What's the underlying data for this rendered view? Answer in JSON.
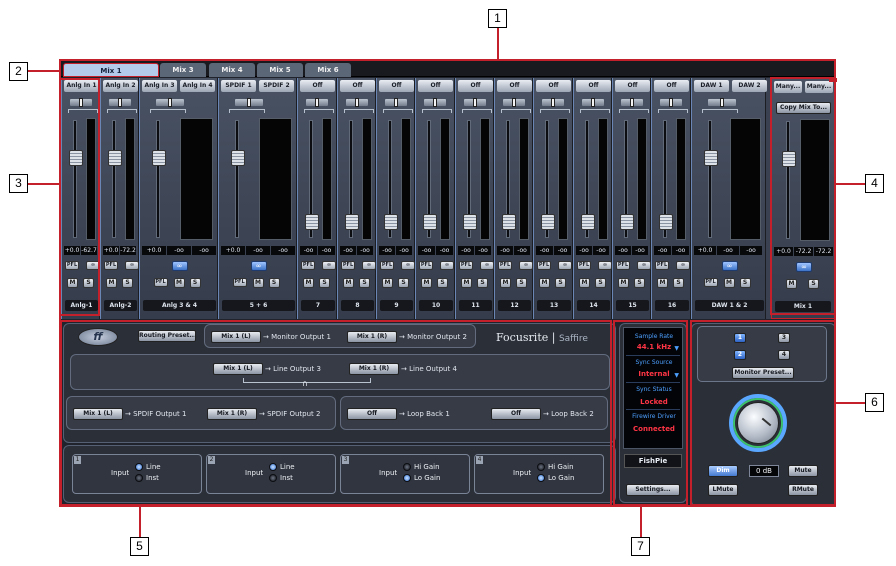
{
  "colors": {
    "accent_red": "#c4202c",
    "panel": "#20232b",
    "link_blue": "#3c72c7",
    "sync_red": "#ff3545",
    "sync_blue": "#4da0ff"
  },
  "tabs": [
    {
      "label": "Mix 1",
      "active": true
    },
    {
      "label": "Mix 3"
    },
    {
      "label": "Mix 4"
    },
    {
      "label": "Mix 5"
    },
    {
      "label": "Mix 6"
    }
  ],
  "groups": [
    {
      "label": "Anlg-1",
      "subs": [
        "Anlg In 1"
      ],
      "readouts": [
        "+0.0",
        "-62.7"
      ],
      "linked": false,
      "buttons": [
        "PFL",
        "M",
        "S"
      ]
    },
    {
      "label": "Anlg-2",
      "subs": [
        "Anlg In 2"
      ],
      "readouts": [
        "+0.0",
        "-72.2"
      ],
      "linked": false,
      "buttons": [
        "PFL",
        "M",
        "S"
      ]
    },
    {
      "label": "Anlg 3 & 4",
      "subs": [
        "Anlg In 3",
        "Anlg In 4"
      ],
      "readouts": [
        "+0.0",
        "-oo",
        "-oo"
      ],
      "linked": true,
      "buttons": [
        "PFL",
        "M",
        "S"
      ]
    },
    {
      "label": "5 + 6",
      "subs": [
        "SPDIF 1",
        "SPDIF 2"
      ],
      "readouts": [
        "+0.0",
        "-oo",
        "-oo"
      ],
      "linked": true,
      "buttons": [
        "PFL",
        "M",
        "S"
      ]
    },
    {
      "label": "7",
      "subs": [
        "Off"
      ],
      "readouts": [
        "-oo",
        "-oo"
      ],
      "buttons": [
        "PFL",
        "M",
        "S"
      ]
    },
    {
      "label": "8",
      "subs": [
        "Off"
      ],
      "readouts": [
        "-oo",
        "-oo"
      ],
      "buttons": [
        "PFL",
        "M",
        "S"
      ]
    },
    {
      "label": "9",
      "subs": [
        "Off"
      ],
      "readouts": [
        "-oo",
        "-oo"
      ],
      "buttons": [
        "PFL",
        "M",
        "S"
      ]
    },
    {
      "label": "10",
      "subs": [
        "Off"
      ],
      "readouts": [
        "-oo",
        "-oo"
      ],
      "buttons": [
        "PFL",
        "M",
        "S"
      ]
    },
    {
      "label": "11",
      "subs": [
        "Off"
      ],
      "readouts": [
        "-oo",
        "-oo"
      ],
      "buttons": [
        "PFL",
        "M",
        "S"
      ]
    },
    {
      "label": "12",
      "subs": [
        "Off"
      ],
      "readouts": [
        "-oo",
        "-oo"
      ],
      "buttons": [
        "PFL",
        "M",
        "S"
      ]
    },
    {
      "label": "13",
      "subs": [
        "Off"
      ],
      "readouts": [
        "-oo",
        "-oo"
      ],
      "buttons": [
        "PFL",
        "M",
        "S"
      ]
    },
    {
      "label": "14",
      "subs": [
        "Off"
      ],
      "readouts": [
        "-oo",
        "-oo"
      ],
      "buttons": [
        "PFL",
        "M",
        "S"
      ]
    },
    {
      "label": "15",
      "subs": [
        "Off"
      ],
      "readouts": [
        "-oo",
        "-oo"
      ],
      "buttons": [
        "PFL",
        "M",
        "S"
      ]
    },
    {
      "label": "16",
      "subs": [
        "Off"
      ],
      "readouts": [
        "-oo",
        "-oo"
      ],
      "buttons": [
        "PFL",
        "M",
        "S"
      ]
    },
    {
      "label": "DAW 1 & 2",
      "subs": [
        "DAW 1",
        "DAW 2"
      ],
      "readouts": [
        "+0.0",
        "-oo",
        "-oo"
      ],
      "linked": true,
      "buttons": [
        "PFL",
        "M",
        "S"
      ]
    }
  ],
  "mix_out": {
    "label": "Mix 1",
    "subs": [
      "Many...",
      "Many..."
    ],
    "copy": "Copy Mix To...",
    "readouts": [
      "+0.0",
      "-72.2",
      "-72.2"
    ],
    "buttons": [
      "M",
      "S"
    ]
  },
  "routing": {
    "preset": "Routing Preset...",
    "monitor": [
      {
        "src": "Mix 1 (L)",
        "dst": "Monitor Output 1"
      },
      {
        "src": "Mix 1 (R)",
        "dst": "Monitor Output 2"
      }
    ],
    "line": [
      {
        "src": "Mix 1 (L)",
        "dst": "Line Output 3"
      },
      {
        "src": "Mix 1 (R)",
        "dst": "Line Output 4"
      }
    ],
    "spdif": [
      {
        "src": "Mix 1 (L)",
        "dst": "SPDIF Output 1"
      },
      {
        "src": "Mix 1 (R)",
        "dst": "SPDIF Output 2"
      }
    ],
    "loop": [
      {
        "src": "Off",
        "dst": "Loop Back 1"
      },
      {
        "src": "Off",
        "dst": "Loop Back 2"
      }
    ]
  },
  "brand": {
    "name": "Focusrite",
    "product": "Saffire"
  },
  "inputs": [
    {
      "num": "1",
      "label": "Input",
      "opts": [
        "Line",
        "Inst"
      ],
      "sel": 0
    },
    {
      "num": "2",
      "label": "Input",
      "opts": [
        "Line",
        "Inst"
      ],
      "sel": 0
    },
    {
      "num": "3",
      "label": "Input",
      "opts": [
        "Hi Gain",
        "Lo Gain"
      ],
      "sel": 1
    },
    {
      "num": "4",
      "label": "Input",
      "opts": [
        "Hi Gain",
        "Lo Gain"
      ],
      "sel": 1
    }
  ],
  "sync": {
    "rate_head": "Sample Rate",
    "rate": "44.1 kHz",
    "source_head": "Sync Source",
    "source": "Internal",
    "status_head": "Sync Status",
    "status": "Locked",
    "driver_head": "Firewire Driver",
    "driver": "Connected",
    "device": "FishPie",
    "settings": "Settings..."
  },
  "monitor": {
    "nums": [
      "1",
      "2",
      "3",
      "4"
    ],
    "preset": "Monitor Preset...",
    "db": "0 dB",
    "dim": "Dim",
    "mute": "Mute",
    "lmute": "LMute",
    "rmute": "RMute"
  },
  "callouts": [
    "1",
    "2",
    "3",
    "4",
    "5",
    "6",
    "7"
  ]
}
